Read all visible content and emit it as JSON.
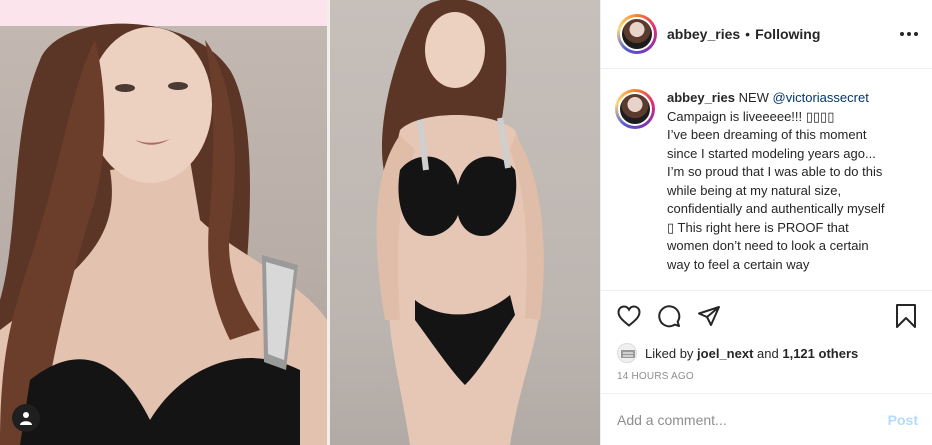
{
  "media": {
    "user_tag_icon": "person-icon"
  },
  "header": {
    "username": "abbey_ries",
    "separator": "•",
    "follow_status": "Following",
    "more_icon": "more-horizontal-icon"
  },
  "caption": {
    "username": "abbey_ries",
    "lines": [
      "NEW",
      "@victoriassecret",
      "Campaign is liveeeee!!! ▯▯▯▯",
      "I’ve been dreaming of this moment",
      "since I started modeling years ago...",
      "I’m so proud that I was able to do this",
      "while being at my natural size,",
      "confidentially and authentically myself",
      "▯ This right here is PROOF that",
      "women don’t need to look a certain",
      "way to feel a certain way"
    ]
  },
  "actions": {
    "like_icon": "heart-icon",
    "comment_icon": "comment-icon",
    "share_icon": "send-icon",
    "save_icon": "bookmark-icon"
  },
  "likes": {
    "prefix": "Liked by",
    "user": "joel_next",
    "conj": "and",
    "others": "1,121 others"
  },
  "timestamp": "14 HOURS AGO",
  "comment": {
    "placeholder": "Add a comment...",
    "post_label": "Post"
  },
  "colors": {
    "link_blue": "#00376b",
    "post_disabled": "#b3dbff",
    "meta_gray": "#8e8e8e"
  }
}
